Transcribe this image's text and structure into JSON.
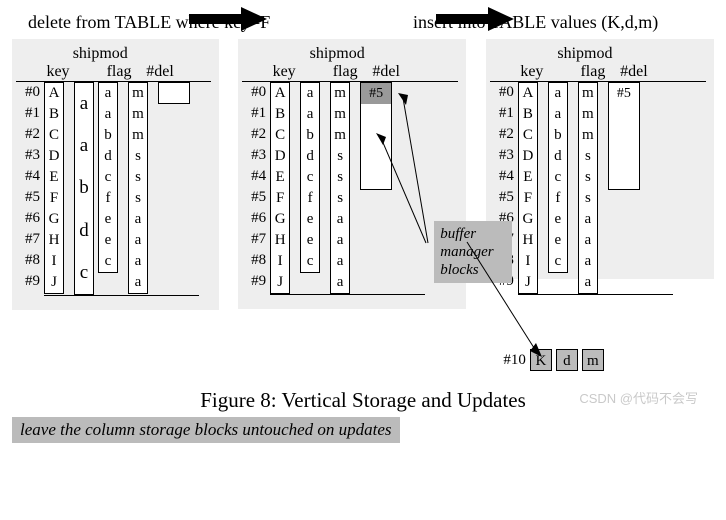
{
  "labels": {
    "delete_sql": "delete from TABLE where key=F",
    "insert_sql": "insert into TABLE values (K,d,m)"
  },
  "headers": {
    "table_name": "shipmod",
    "col_key": "key",
    "col_flag": "flag",
    "col_del": "#del"
  },
  "rows": [
    "#0",
    "#1",
    "#2",
    "#3",
    "#4",
    "#5",
    "#6",
    "#7",
    "#8",
    "#9"
  ],
  "key_vals": [
    "A",
    "B",
    "C",
    "D",
    "E",
    "F",
    "G",
    "H",
    "I",
    "J"
  ],
  "mid_vals": [
    "a",
    "a",
    "b",
    "d",
    "c",
    "f",
    "e",
    "e",
    "c"
  ],
  "tall_vals": [
    "a",
    "a",
    "b",
    "d",
    "c"
  ],
  "flag_vals": [
    "m",
    "m",
    "m",
    "s",
    "s",
    "s",
    "a",
    "a",
    "a",
    "a"
  ],
  "del_entry": "#5",
  "notes": {
    "buffer": "buffer manager blocks",
    "leave": "leave the column storage blocks untouched on updates"
  },
  "insert": {
    "rownum": "#10",
    "cells": [
      "K",
      "d",
      "m"
    ]
  },
  "caption": "Figure 8: Vertical Storage and Updates",
  "watermark": "CSDN @代码不会写"
}
